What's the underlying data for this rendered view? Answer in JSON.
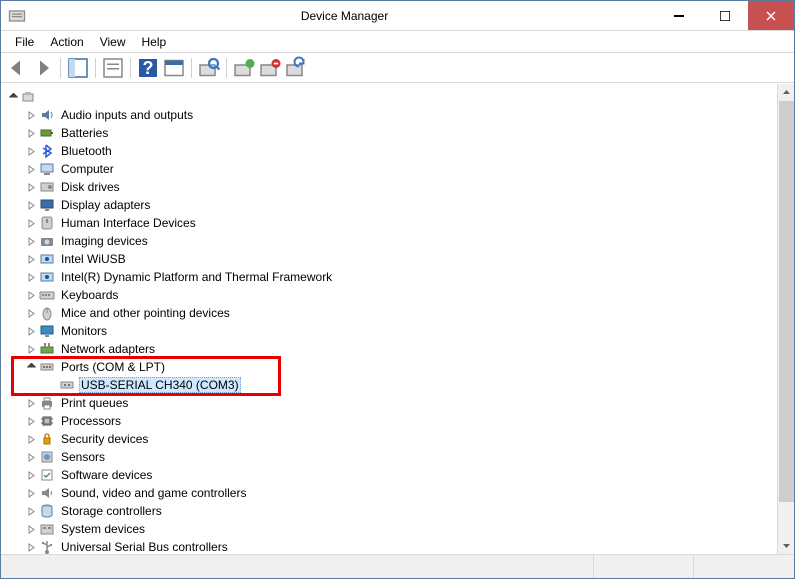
{
  "window": {
    "title": "Device Manager"
  },
  "menubar": {
    "items": [
      "File",
      "Action",
      "View",
      "Help"
    ]
  },
  "tree": {
    "root_expanded": true,
    "categories": [
      {
        "icon": "audio",
        "label": "Audio inputs and outputs",
        "expanded": false
      },
      {
        "icon": "battery",
        "label": "Batteries",
        "expanded": false
      },
      {
        "icon": "bluetooth",
        "label": "Bluetooth",
        "expanded": false
      },
      {
        "icon": "computer",
        "label": "Computer",
        "expanded": false
      },
      {
        "icon": "disk",
        "label": "Disk drives",
        "expanded": false
      },
      {
        "icon": "display",
        "label": "Display adapters",
        "expanded": false
      },
      {
        "icon": "hid",
        "label": "Human Interface Devices",
        "expanded": false
      },
      {
        "icon": "imaging",
        "label": "Imaging devices",
        "expanded": false
      },
      {
        "icon": "intel",
        "label": "Intel WiUSB",
        "expanded": false
      },
      {
        "icon": "intel",
        "label": "Intel(R) Dynamic Platform and Thermal Framework",
        "expanded": false
      },
      {
        "icon": "keyboard",
        "label": "Keyboards",
        "expanded": false
      },
      {
        "icon": "mouse",
        "label": "Mice and other pointing devices",
        "expanded": false
      },
      {
        "icon": "monitor",
        "label": "Monitors",
        "expanded": false
      },
      {
        "icon": "network",
        "label": "Network adapters",
        "expanded": false
      },
      {
        "icon": "ports",
        "label": "Ports (COM & LPT)",
        "expanded": true,
        "children": [
          {
            "icon": "port",
            "label": "USB-SERIAL CH340 (COM3)",
            "selected": true
          }
        ]
      },
      {
        "icon": "printer",
        "label": "Print queues",
        "expanded": false
      },
      {
        "icon": "cpu",
        "label": "Processors",
        "expanded": false
      },
      {
        "icon": "security",
        "label": "Security devices",
        "expanded": false
      },
      {
        "icon": "sensor",
        "label": "Sensors",
        "expanded": false
      },
      {
        "icon": "software",
        "label": "Software devices",
        "expanded": false
      },
      {
        "icon": "sound",
        "label": "Sound, video and game controllers",
        "expanded": false
      },
      {
        "icon": "storage",
        "label": "Storage controllers",
        "expanded": false
      },
      {
        "icon": "system",
        "label": "System devices",
        "expanded": false
      },
      {
        "icon": "usb",
        "label": "Universal Serial Bus controllers",
        "expanded": false
      }
    ]
  }
}
